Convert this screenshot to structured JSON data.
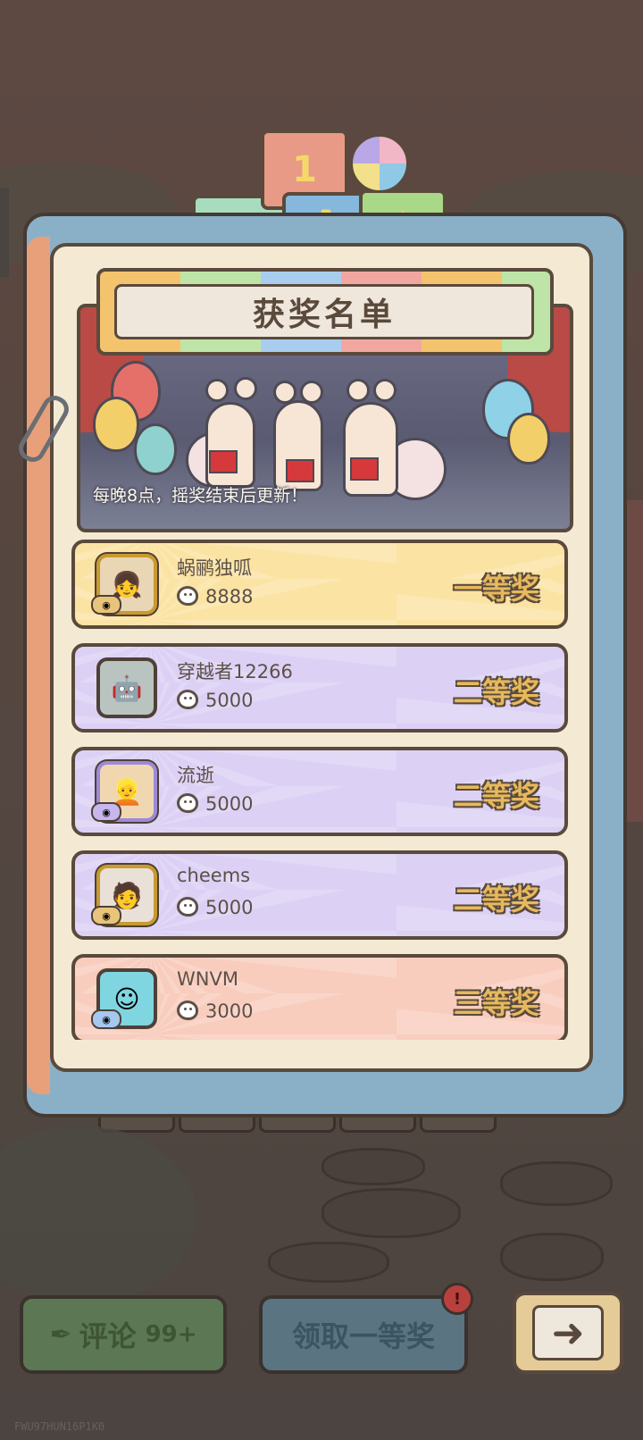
{
  "title": "获奖名单",
  "banner_caption": "每晚8点，摇奖结束后更新！",
  "block_labels": [
    "1",
    "A"
  ],
  "winners": [
    {
      "name": "蜗鹂独呱",
      "score": "8888",
      "prize": "一等奖",
      "tier": "gold",
      "avatar_icon": "girl-avatar-icon"
    },
    {
      "name": "穿越者12266",
      "score": "5000",
      "prize": "二等奖",
      "tier": "purple",
      "avatar_icon": "robot-avatar-icon"
    },
    {
      "name": "流逝",
      "score": "5000",
      "prize": "二等奖",
      "tier": "purple",
      "avatar_icon": "blonde-avatar-icon"
    },
    {
      "name": "cheems",
      "score": "5000",
      "prize": "二等奖",
      "tier": "purple",
      "avatar_icon": "dark-hair-avatar-icon"
    },
    {
      "name": "WNVM",
      "score": "3000",
      "prize": "三等奖",
      "tier": "pink",
      "avatar_icon": "blue-creature-avatar-icon"
    }
  ],
  "bottom_bar": {
    "comment_label": "评论",
    "comment_count": "99+",
    "claim_label": "领取一等奖",
    "alert_mark": "!"
  },
  "watermark": "FWU97HUN16P1K0",
  "colors": {
    "gold_row": "#fbe3a3",
    "purple_row": "#dcd1f5",
    "pink_row": "#f8cdbd",
    "prize_text": "#e7b95d",
    "outline": "#5a4a3c"
  }
}
